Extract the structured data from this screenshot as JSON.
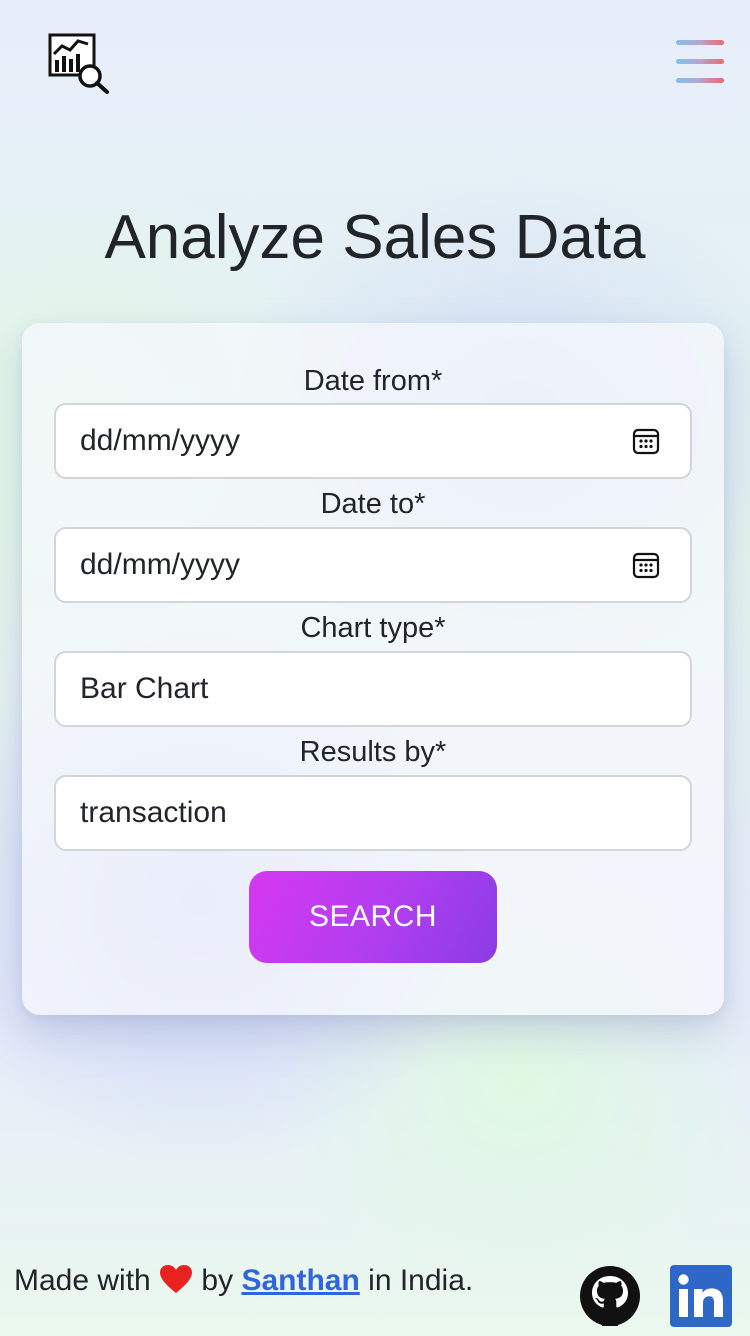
{
  "header": {
    "logo_icon": "analytics-search-icon",
    "menu_icon": "hamburger-menu-icon"
  },
  "page": {
    "title": "Analyze Sales Data"
  },
  "form": {
    "date_from": {
      "label": "Date from*",
      "placeholder": "dd/mm/yyyy",
      "icon": "calendar-icon"
    },
    "date_to": {
      "label": "Date to*",
      "placeholder": "dd/mm/yyyy",
      "icon": "calendar-icon"
    },
    "chart_type": {
      "label": "Chart type*",
      "value": "Bar Chart"
    },
    "results_by": {
      "label": "Results by*",
      "value": "transaction"
    },
    "search_label": "SEARCH"
  },
  "footer": {
    "made_with": "Made with",
    "by": "by",
    "author": "Santhan",
    "suffix": "in India.",
    "heart_icon": "heart-icon",
    "github_icon": "github-icon",
    "linkedin_icon": "linkedin-icon"
  },
  "colors": {
    "accent_start": "#d637ef",
    "accent_end": "#8a3ce6",
    "link": "#2f66e0",
    "heart": "#e8221e",
    "linkedin": "#2f67c7"
  }
}
